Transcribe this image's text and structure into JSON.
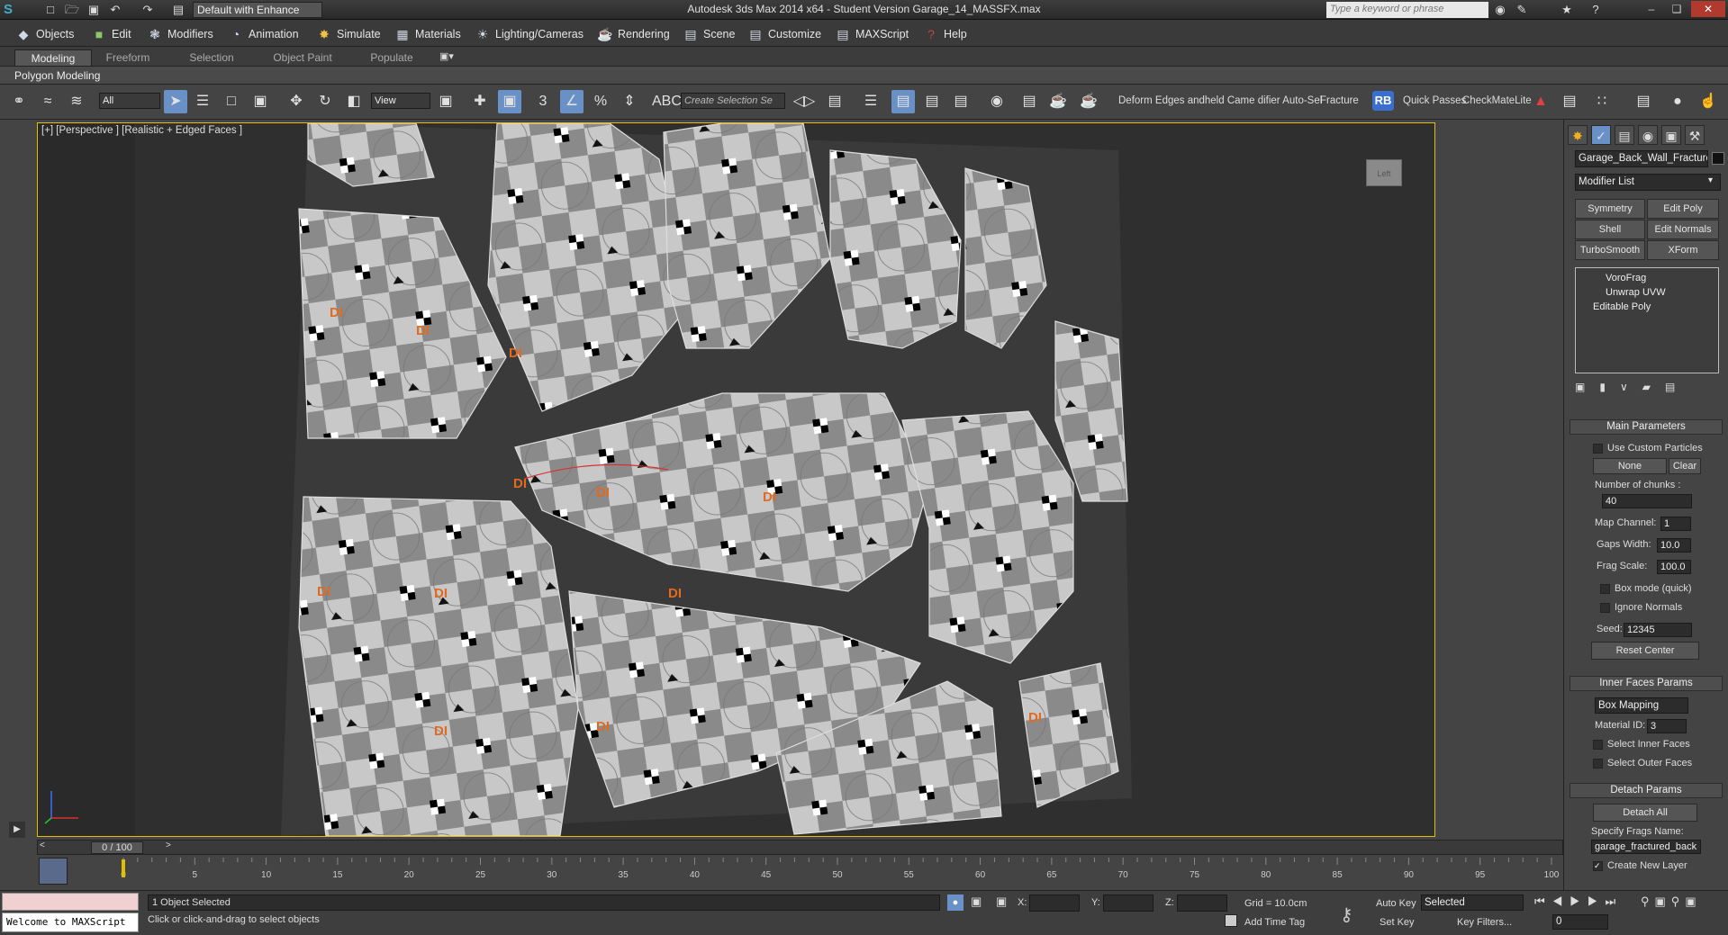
{
  "app": {
    "title": "Autodesk 3ds Max  2014 x64  - Student Version    Garage_14_MASSFX.max",
    "workspace": "Default with Enhance",
    "search_placeholder": "Type a keyword or phrase"
  },
  "menu": [
    "Objects",
    "Edit",
    "Modifiers",
    "Animation",
    "Simulate",
    "Materials",
    "Lighting/Cameras",
    "Rendering",
    "Scene",
    "Customize",
    "MAXScript",
    "Help"
  ],
  "ribbon": {
    "tabs": [
      "Modeling",
      "Freeform",
      "Selection",
      "Object Paint",
      "Populate"
    ],
    "active_tab": "Modeling",
    "sub_label": "Polygon Modeling"
  },
  "toolbar": {
    "filter": "All",
    "ref_coord": "View",
    "selection_set_placeholder": "Create Selection Se",
    "custom_text": "Deform Edges andheld Came difier Auto-Sel",
    "fracture": "Fracture",
    "rb": "RB",
    "quick_passes": "Quick Passes",
    "checkmate": "CheckMateLite"
  },
  "viewport": {
    "label": "[+] [Perspective ] [Realistic + Edged Faces ]",
    "texture_label": "DI",
    "viewcube": "Left"
  },
  "command_panel": {
    "object_name": "Garage_Back_Wall_Fracture",
    "modifier_list": "Modifier List",
    "quick_buttons": [
      "Symmetry",
      "Edit Poly",
      "Shell",
      "Edit Normals",
      "TurboSmooth",
      "XForm"
    ],
    "stack": [
      "VoroFrag",
      "Unwrap UVW",
      "Editable Poly"
    ],
    "main_params": {
      "title": "Main Parameters",
      "use_custom_particles": "Use Custom Particles",
      "none_btn": "None",
      "clear_btn": "Clear",
      "num_chunks_label": "Number of chunks :",
      "num_chunks": "40",
      "map_channel_label": "Map Channel:",
      "map_channel": "1",
      "gaps_width_label": "Gaps Width:",
      "gaps_width": "10.0",
      "frag_scale_label": "Frag Scale:",
      "frag_scale": "100.0",
      "box_mode": "Box mode (quick)",
      "ignore_normals": "Ignore Normals",
      "seed_label": "Seed:",
      "seed": "12345",
      "reset_center": "Reset Center"
    },
    "inner_faces": {
      "title": "Inner Faces Params",
      "mapping": "Box Mapping",
      "material_id_label": "Material ID:",
      "material_id": "3",
      "select_inner": "Select Inner Faces",
      "select_outer": "Select Outer Faces"
    },
    "detach": {
      "title": "Detach Params",
      "detach_all": "Detach All",
      "specify_label": "Specify Frags Name:",
      "frags_name": "garage_fractured_back",
      "create_new_layer": "Create New Layer"
    }
  },
  "timeline": {
    "frame": "0 / 100",
    "ticks": [
      "0",
      "5",
      "10",
      "15",
      "20",
      "25",
      "30",
      "35",
      "40",
      "45",
      "50",
      "55",
      "60",
      "65",
      "70",
      "75",
      "80",
      "85",
      "90",
      "95",
      "100"
    ]
  },
  "status": {
    "maxscript": "Welcome to MAXScript",
    "selected": "1 Object Selected",
    "prompt": "Click or click-and-drag to select objects",
    "x_label": "X:",
    "y_label": "Y:",
    "z_label": "Z:",
    "grid": "Grid = 10.0cm",
    "add_time_tag": "Add Time Tag",
    "auto_key": "Auto Key",
    "set_key": "Set Key",
    "key_mode": "Selected",
    "key_filters": "Key Filters...",
    "current_frame": "0"
  }
}
